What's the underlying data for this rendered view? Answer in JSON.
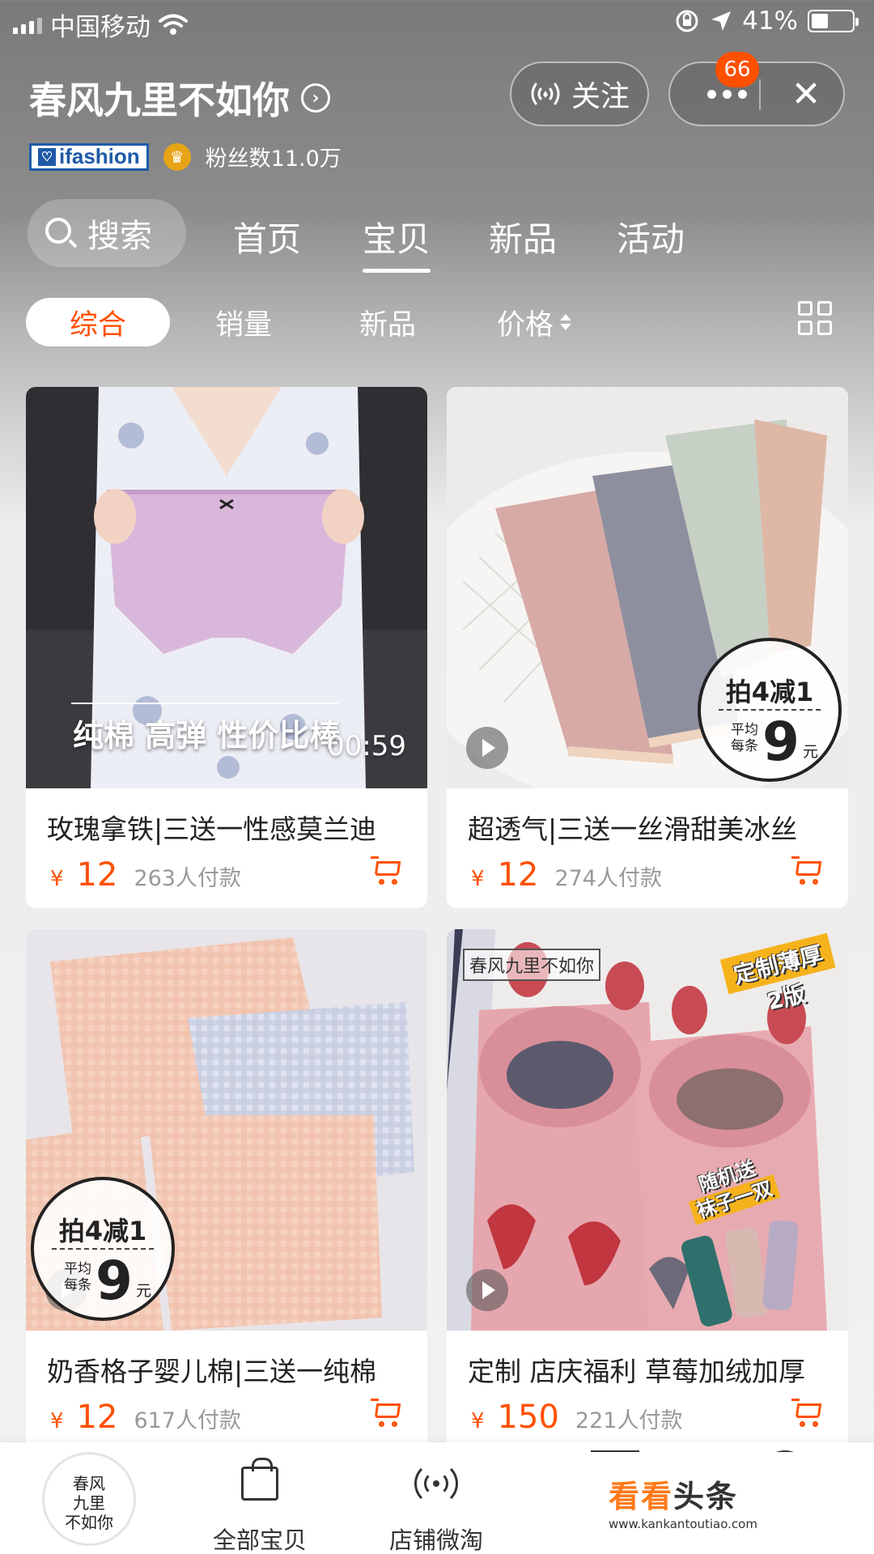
{
  "status_bar": {
    "carrier": "中国移动",
    "battery": "41%",
    "battery_level": 0.41
  },
  "header": {
    "shop_name": "春风九里不如你",
    "follow_label": "关注",
    "message_badge": "66",
    "close_label": "✕",
    "brand_logo": "ifashion",
    "fans": "粉丝数11.0万"
  },
  "nav": {
    "search_label": "搜索",
    "tabs": [
      "首页",
      "宝贝",
      "新品",
      "活动"
    ],
    "active_tab": "宝贝"
  },
  "sort": {
    "tabs": [
      "综合",
      "销量",
      "新品",
      "价格"
    ],
    "active": "综合"
  },
  "products": [
    {
      "name": "玫瑰拿铁|三送一性感莫兰迪",
      "currency": "¥",
      "price": "12",
      "sold": "263人付款",
      "caption": "纯棉 高弹 性价比棒",
      "duration": "00:59"
    },
    {
      "name": "超透气|三送一丝滑甜美冰丝",
      "currency": "¥",
      "price": "12",
      "sold": "274人付款",
      "promo": {
        "line1": "拍4减1",
        "avg": "平均每条",
        "num": "9",
        "unit": "元"
      }
    },
    {
      "name": "奶香格子婴儿棉|三送一纯棉",
      "currency": "¥",
      "price": "12",
      "sold": "617人付款",
      "promo": {
        "line1": "拍4减1",
        "avg": "平均每条",
        "num": "9",
        "unit": "元"
      }
    },
    {
      "name": "定制 店庆福利 草莓加绒加厚",
      "currency": "¥",
      "price": "150",
      "sold": "221人付款",
      "shop_tag": "春风九里不如你",
      "custom_tag_1": "定制薄厚",
      "custom_tag_2": "2版",
      "sock_tag_1": "随机送",
      "sock_tag_2": "袜子一双"
    }
  ],
  "bottom_nav": {
    "avatar_text": [
      "春风",
      "九里",
      "不如你"
    ],
    "items": [
      "全部宝贝",
      "店铺微淘"
    ]
  },
  "watermark": {
    "brand_a": "看看",
    "brand_b": "头条",
    "url": "www.kankantoutiao.com"
  },
  "colors": {
    "accent": "#ff5000",
    "card_bg": "#ffffff"
  }
}
